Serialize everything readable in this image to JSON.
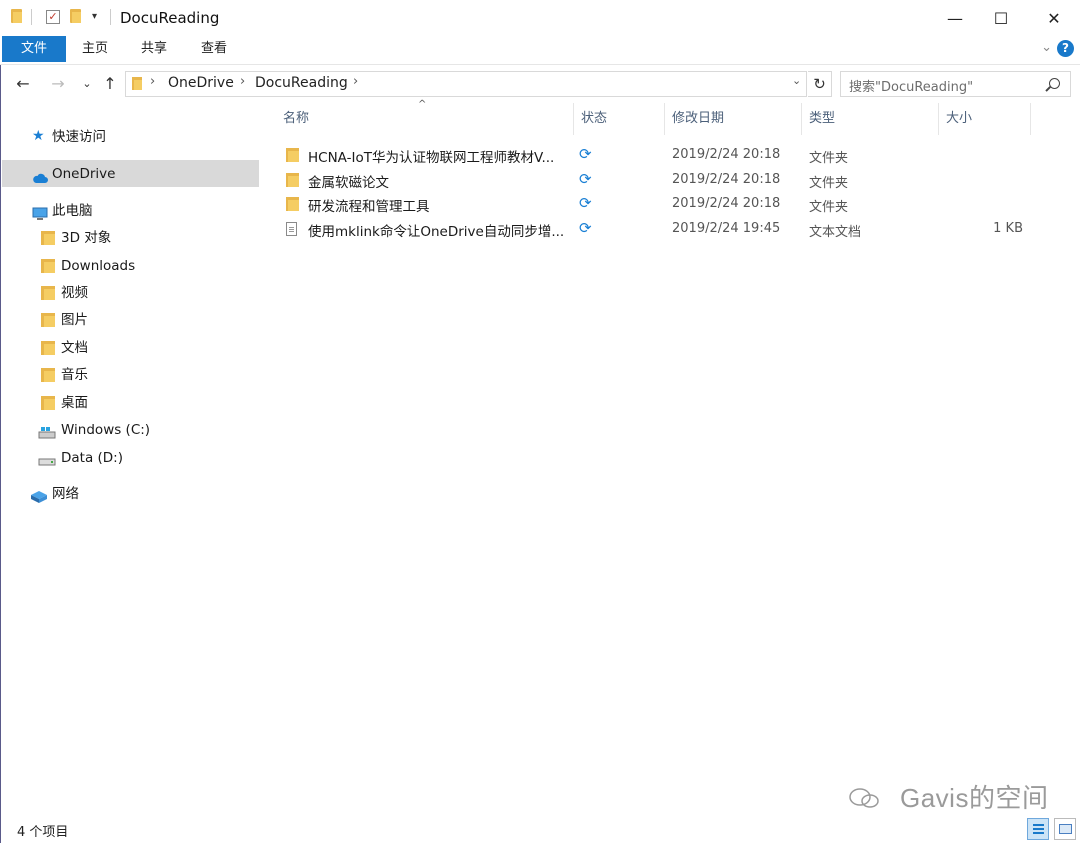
{
  "window": {
    "title": "DocuReading",
    "minimize_glyph": "—",
    "maximize_glyph": "☐",
    "close_glyph": "✕"
  },
  "ribbon": {
    "tabs": [
      "文件",
      "主页",
      "共享",
      "查看"
    ],
    "help_glyph": "?",
    "accent_color": "#1979ca"
  },
  "address": {
    "breadcrumbs": [
      "OneDrive",
      "DocuReading"
    ],
    "separator": "›",
    "search_placeholder": "搜索\"DocuReading\""
  },
  "sidebar": {
    "items": [
      {
        "label": "快速访问",
        "icon": "star-icon"
      },
      {
        "label": "OneDrive",
        "icon": "cloud-icon",
        "selected": true
      },
      {
        "label": "此电脑",
        "icon": "computer-icon"
      },
      {
        "label": "3D 对象",
        "icon": "3d-objects-folder-icon"
      },
      {
        "label": "Downloads",
        "icon": "downloads-folder-icon"
      },
      {
        "label": "视频",
        "icon": "videos-folder-icon"
      },
      {
        "label": "图片",
        "icon": "pictures-folder-icon"
      },
      {
        "label": "文档",
        "icon": "documents-folder-icon"
      },
      {
        "label": "音乐",
        "icon": "music-folder-icon"
      },
      {
        "label": "桌面",
        "icon": "desktop-folder-icon"
      },
      {
        "label": "Windows (C:)",
        "icon": "windows-drive-icon"
      },
      {
        "label": "Data (D:)",
        "icon": "drive-icon"
      },
      {
        "label": "网络",
        "icon": "network-icon"
      }
    ]
  },
  "columns": [
    "名称",
    "状态",
    "修改日期",
    "类型",
    "大小"
  ],
  "files": [
    {
      "name": "HCNA-IoT华为认证物联网工程师教材V...",
      "status_icon": "sync-icon",
      "date": "2019/2/24 20:18",
      "type": "文件夹",
      "size": "",
      "kind": "folder"
    },
    {
      "name": "金属软磁论文",
      "status_icon": "sync-icon",
      "date": "2019/2/24 20:18",
      "type": "文件夹",
      "size": "",
      "kind": "folder"
    },
    {
      "name": "研发流程和管理工具",
      "status_icon": "sync-icon",
      "date": "2019/2/24 20:18",
      "type": "文件夹",
      "size": "",
      "kind": "folder"
    },
    {
      "name": "使用mklink命令让OneDrive自动同步增...",
      "status_icon": "sync-icon",
      "date": "2019/2/24 19:45",
      "type": "文本文档",
      "size": "1 KB",
      "kind": "text"
    }
  ],
  "statusbar": {
    "item_count": "4 个项目"
  },
  "watermark": "Gavis的空间"
}
